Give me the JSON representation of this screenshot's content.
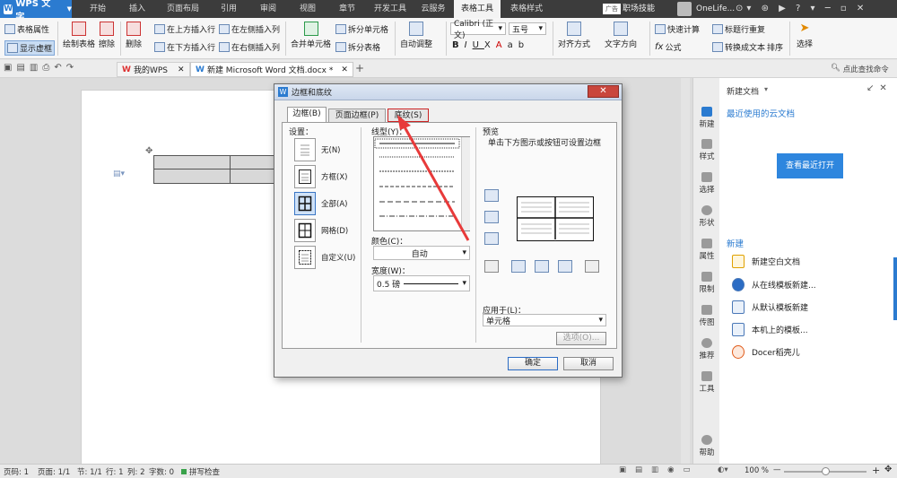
{
  "menubar": {
    "app_label": "WPS 文字",
    "tabs": [
      "开始",
      "插入",
      "页面布局",
      "引用",
      "审阅",
      "视图",
      "章节",
      "开发工具",
      "云服务",
      "表格工具",
      "表格样式"
    ],
    "active_tab": "表格工具",
    "ad_badge": "广告",
    "right_link": "职场技能",
    "user": "OneLife..."
  },
  "ribbon": {
    "table_props": "表格属性",
    "show_gridlines": "显示虚框",
    "draw_table": "绘制表格",
    "erase": "擦除",
    "delete": "删除",
    "insert_above": "在上方插入行",
    "insert_below": "在下方插入行",
    "insert_left": "在左侧插入列",
    "insert_right": "在右侧插入列",
    "merge_cells": "合并单元格",
    "split_cells": "拆分单元格",
    "split_table": "拆分表格",
    "auto_fit": "自动调整",
    "font_name": "Calibri (正文)",
    "font_size": "五号",
    "align": "对齐方式",
    "text_direction": "文字方向",
    "quick_calc": "快速计算",
    "header_repeat": "标题行重复",
    "formula": "公式",
    "to_text": "转换成文本",
    "sort": "排序",
    "select": "选择"
  },
  "quickbar": {
    "tab1": "我的WPS",
    "tab2": "新建 Microsoft Word 文档.docx *",
    "search": "点此查找命令"
  },
  "dialog": {
    "title": "边框和底纹",
    "tabs": [
      "边框(B)",
      "页面边框(P)",
      "底纹(S)"
    ],
    "setting_label": "设置：",
    "settings": [
      "无(N)",
      "方框(X)",
      "全部(A)",
      "网格(D)",
      "自定义(U)"
    ],
    "line_style_label": "线型(Y)：",
    "color_label": "颜色(C)：",
    "color_value": "自动",
    "width_label": "宽度(W)：",
    "width_value": "0.5  磅",
    "preview_label": "预览",
    "preview_hint": "单击下方图示或按钮可设置边框",
    "apply_label": "应用于(L)：",
    "apply_value": "单元格",
    "options_button": "选项(O)...",
    "ok_button": "确定",
    "cancel_button": "取消"
  },
  "rightbar": {
    "items": [
      "新建",
      "样式",
      "选择",
      "形状",
      "属性",
      "限制",
      "传图",
      "推荐",
      "工具",
      "帮助"
    ]
  },
  "panel": {
    "title": "新建文档",
    "recent_cloud": "最近使用的云文档",
    "view_recent_button": "查看最近打开",
    "new_section": "新建",
    "items": [
      "新建空白文档",
      "从在线模板新建...",
      "从默认模板新建",
      "本机上的模板...",
      "Docer稻壳儿"
    ]
  },
  "statusbar": {
    "page_no": "页码: 1",
    "page": "页面: 1/1",
    "section": "节: 1/1",
    "row": "行: 1",
    "col": "列: 2",
    "words": "字数: 0",
    "spell": "拼写检查",
    "zoom": "100 %"
  },
  "colors": {
    "accent_blue": "#2b7bd0",
    "arrow_red": "#e83a3a",
    "dark_bar": "#3c3c3c"
  }
}
